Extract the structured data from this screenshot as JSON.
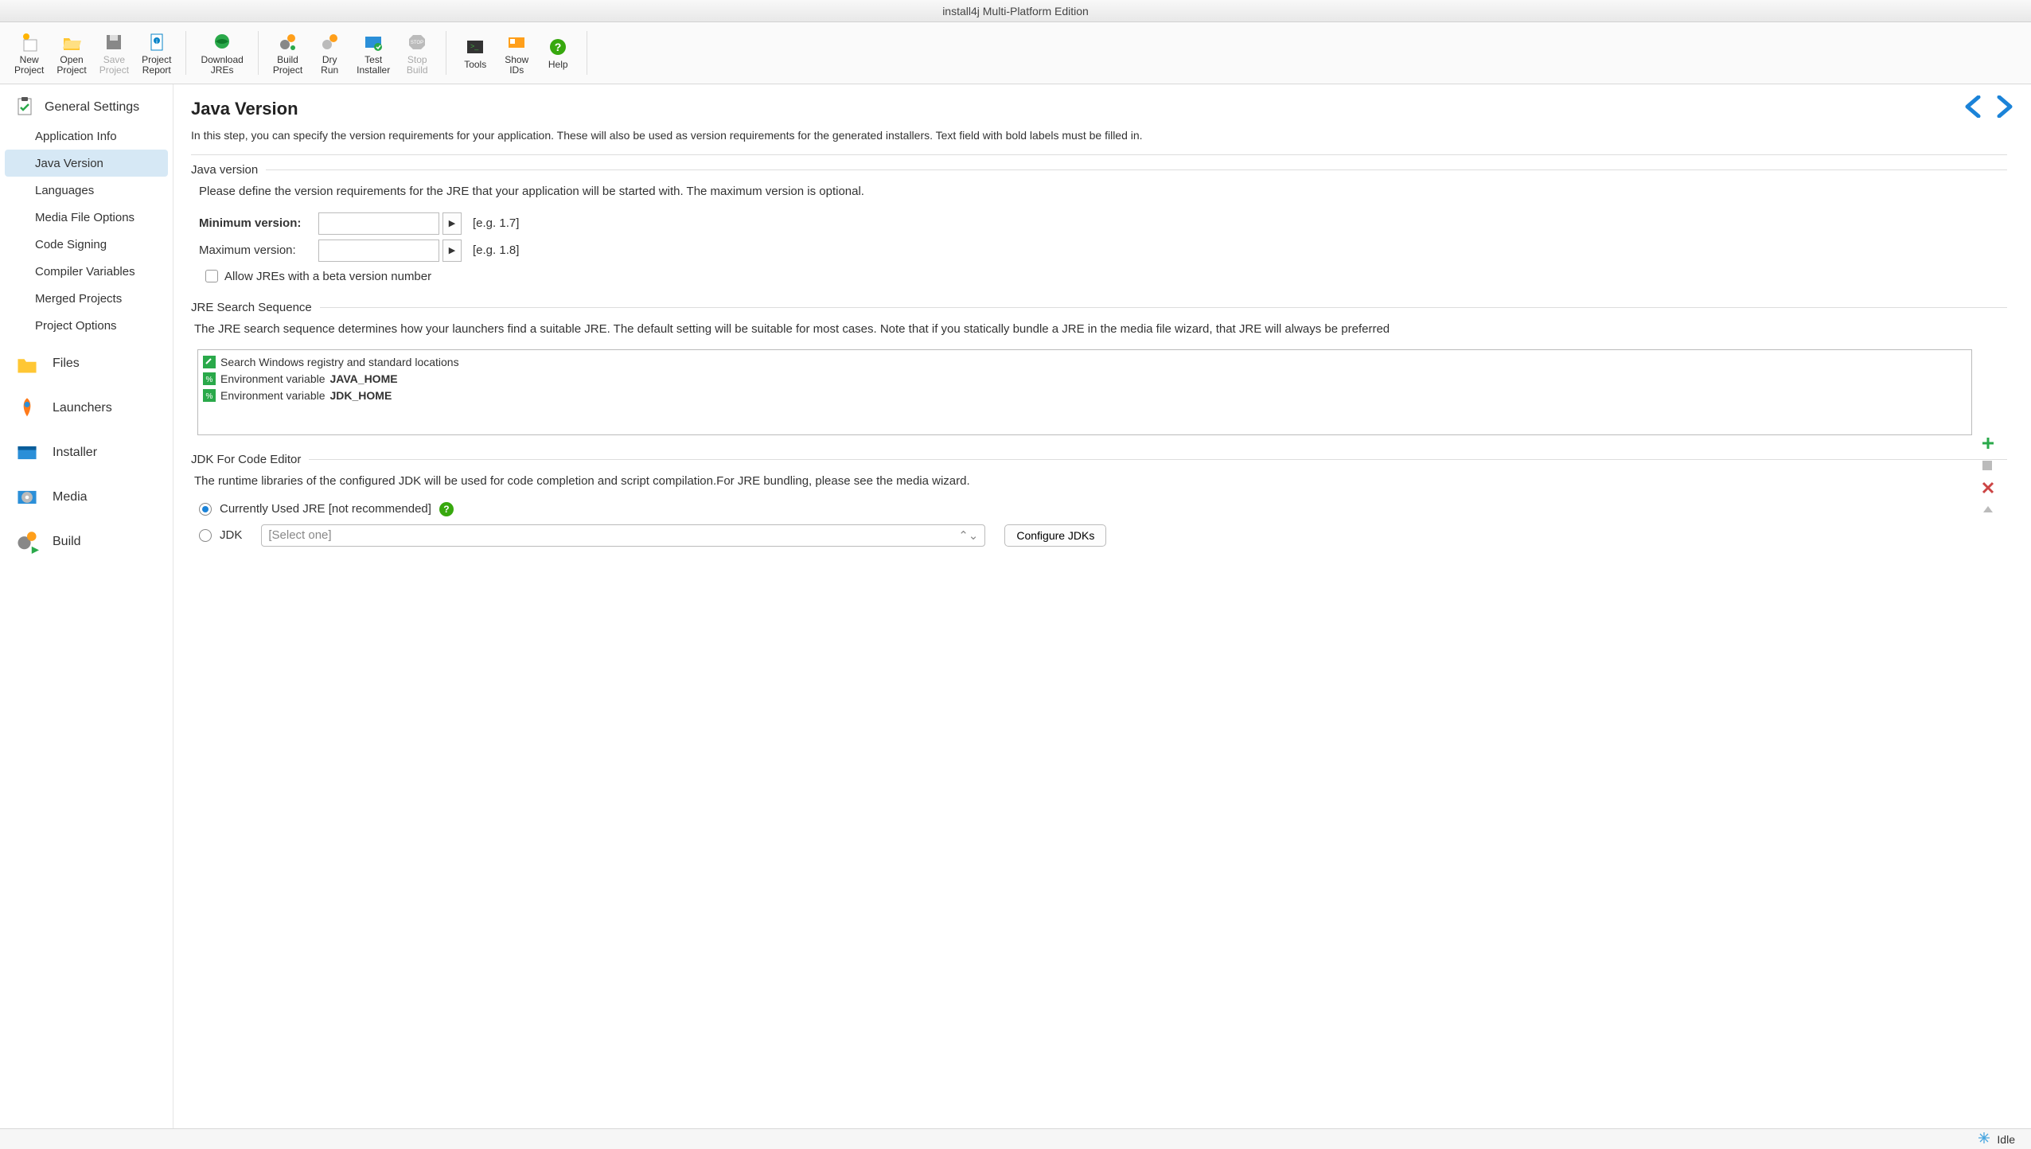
{
  "window": {
    "title": "install4j Multi-Platform Edition"
  },
  "toolbar": {
    "new_project": "New\nProject",
    "open_project": "Open\nProject",
    "save_project": "Save\nProject",
    "project_report": "Project\nReport",
    "download_jres": "Download\nJREs",
    "build_project": "Build\nProject",
    "dry_run": "Dry\nRun",
    "test_installer": "Test\nInstaller",
    "stop_build": "Stop\nBuild",
    "tools": "Tools",
    "show_ids": "Show\nIDs",
    "help": "Help"
  },
  "sidebar": {
    "sections": {
      "general": "General Settings",
      "files": "Files",
      "launchers": "Launchers",
      "installer": "Installer",
      "media": "Media",
      "build": "Build"
    },
    "items": [
      {
        "label": "Application Info"
      },
      {
        "label": "Java Version"
      },
      {
        "label": "Languages"
      },
      {
        "label": "Media File Options"
      },
      {
        "label": "Code Signing"
      },
      {
        "label": "Compiler Variables"
      },
      {
        "label": "Merged Projects"
      },
      {
        "label": "Project Options"
      }
    ]
  },
  "page": {
    "title": "Java Version",
    "desc": "In this step, you can specify the version requirements for your application. These will also be used as version requirements for the generated installers. Text field with bold labels must be filled in."
  },
  "java_version": {
    "legend": "Java version",
    "desc": "Please define the version requirements for the JRE that your application will be started with. The maximum version is optional.",
    "min_label": "Minimum version:",
    "min_value": "",
    "min_hint": "[e.g. 1.7]",
    "max_label": "Maximum version:",
    "max_value": "",
    "max_hint": "[e.g. 1.8]",
    "allow_beta": "Allow JREs with a beta version number"
  },
  "jre_search": {
    "legend": "JRE Search Sequence",
    "desc": "The JRE search sequence determines how your launchers find a suitable JRE. The default setting will be suitable for most cases. Note that if you statically bundle a JRE in the media file wizard, that JRE will always be preferred",
    "items": [
      {
        "text_prefix": "Search Windows registry and standard locations"
      },
      {
        "text_prefix": "Environment variable ",
        "text_bold": "JAVA_HOME"
      },
      {
        "text_prefix": "Environment variable ",
        "text_bold": "JDK_HOME"
      }
    ]
  },
  "jdk": {
    "legend": "JDK For Code Editor",
    "desc": "The runtime libraries of the configured JDK will be used for code completion and script compilation.For JRE bundling, please see the media wizard.",
    "radio_current": "Currently Used JRE [not recommended]",
    "radio_jdk": "JDK",
    "select_placeholder": "[Select one]",
    "configure_btn": "Configure JDKs"
  },
  "status": {
    "state": "Idle"
  }
}
